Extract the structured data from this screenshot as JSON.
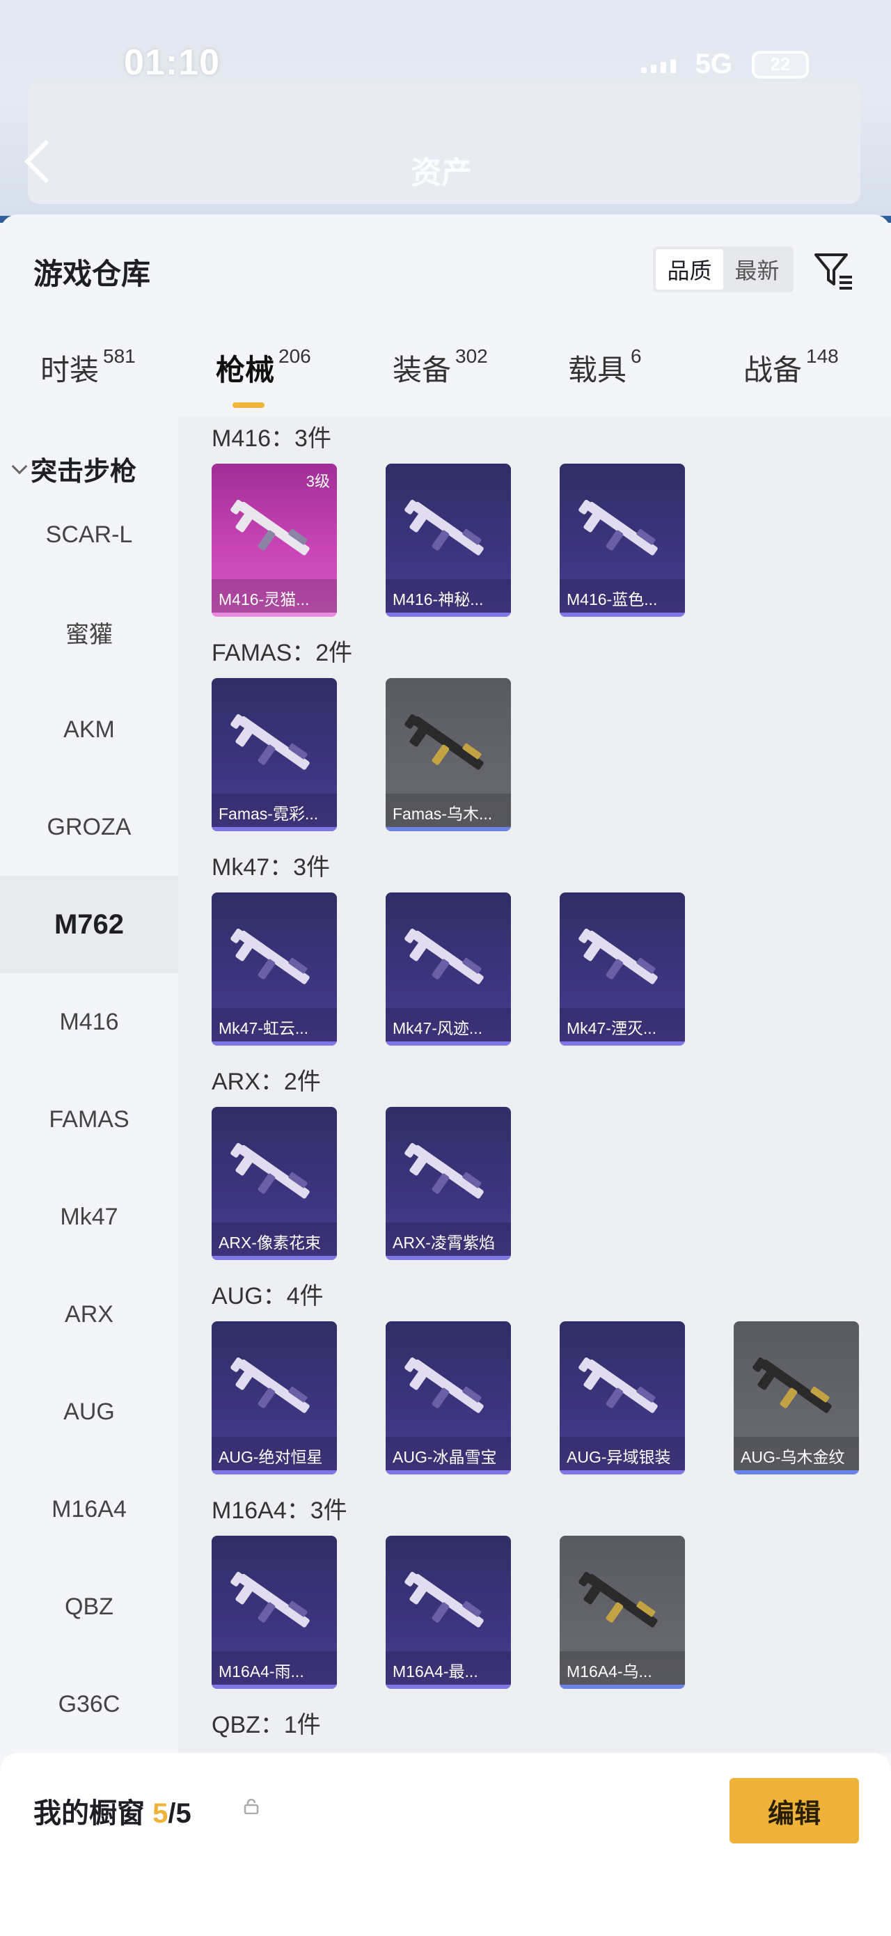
{
  "status": {
    "time": "01:10",
    "network": "5G",
    "battery": "22"
  },
  "top": {
    "title": "资产"
  },
  "warehouse": {
    "title": "游戏仓库",
    "sort_quality": "品质",
    "sort_newest": "最新"
  },
  "tabs": [
    {
      "label": "时装",
      "count": "581"
    },
    {
      "label": "枪械",
      "count": "206"
    },
    {
      "label": "装备",
      "count": "302"
    },
    {
      "label": "载具",
      "count": "6"
    },
    {
      "label": "战备",
      "count": "148"
    }
  ],
  "sidebar": {
    "group": "突击步枪",
    "items": [
      "SCAR-L",
      "蜜獾",
      "AKM",
      "GROZA",
      "M762",
      "M416",
      "FAMAS",
      "Mk47",
      "ARX",
      "AUG",
      "M16A4",
      "QBZ",
      "G36C"
    ],
    "active": "M762"
  },
  "groups": [
    {
      "title": "M416：3件",
      "items": [
        {
          "name": "M416-灵猫...",
          "tier": "3级",
          "style": "gold"
        },
        {
          "name": "M416-神秘...",
          "style": "purple"
        },
        {
          "name": "M416-蓝色...",
          "style": "purple"
        }
      ]
    },
    {
      "title": "FAMAS：2件",
      "items": [
        {
          "name": "Famas-霓彩...",
          "style": "purple"
        },
        {
          "name": "Famas-乌木...",
          "style": "grey"
        }
      ]
    },
    {
      "title": "Mk47：3件",
      "items": [
        {
          "name": "Mk47-虹云...",
          "style": "purple"
        },
        {
          "name": "Mk47-风迹...",
          "style": "purple"
        },
        {
          "name": "Mk47-湮灭...",
          "style": "purple"
        }
      ]
    },
    {
      "title": "ARX：2件",
      "items": [
        {
          "name": "ARX-像素花束",
          "style": "purple"
        },
        {
          "name": "ARX-凌霄紫焰",
          "style": "purple"
        }
      ]
    },
    {
      "title": "AUG：4件",
      "items": [
        {
          "name": "AUG-绝对恒星",
          "style": "purple"
        },
        {
          "name": "AUG-冰晶雪宝",
          "style": "purple"
        },
        {
          "name": "AUG-异域银装",
          "style": "purple"
        },
        {
          "name": "AUG-乌木金纹",
          "style": "grey"
        }
      ]
    },
    {
      "title": "M16A4：3件",
      "items": [
        {
          "name": "M16A4-雨...",
          "style": "purple"
        },
        {
          "name": "M16A4-最...",
          "style": "purple"
        },
        {
          "name": "M16A4-乌...",
          "style": "grey"
        }
      ]
    },
    {
      "title": "QBZ：1件",
      "items": []
    }
  ],
  "showcase": {
    "label": "我的橱窗",
    "count": "5",
    "total": "/5",
    "edit": "编辑"
  },
  "colors": {
    "accent": "#f0b33a",
    "card_purple": "#3c3580",
    "card_gold": "#c944b6",
    "card_grey": "#6b6b74"
  },
  "icons": [
    "back-arrow-icon",
    "filter-icon",
    "lock-icon",
    "share-icon",
    "chevron-down-icon",
    "rifle-icon"
  ]
}
